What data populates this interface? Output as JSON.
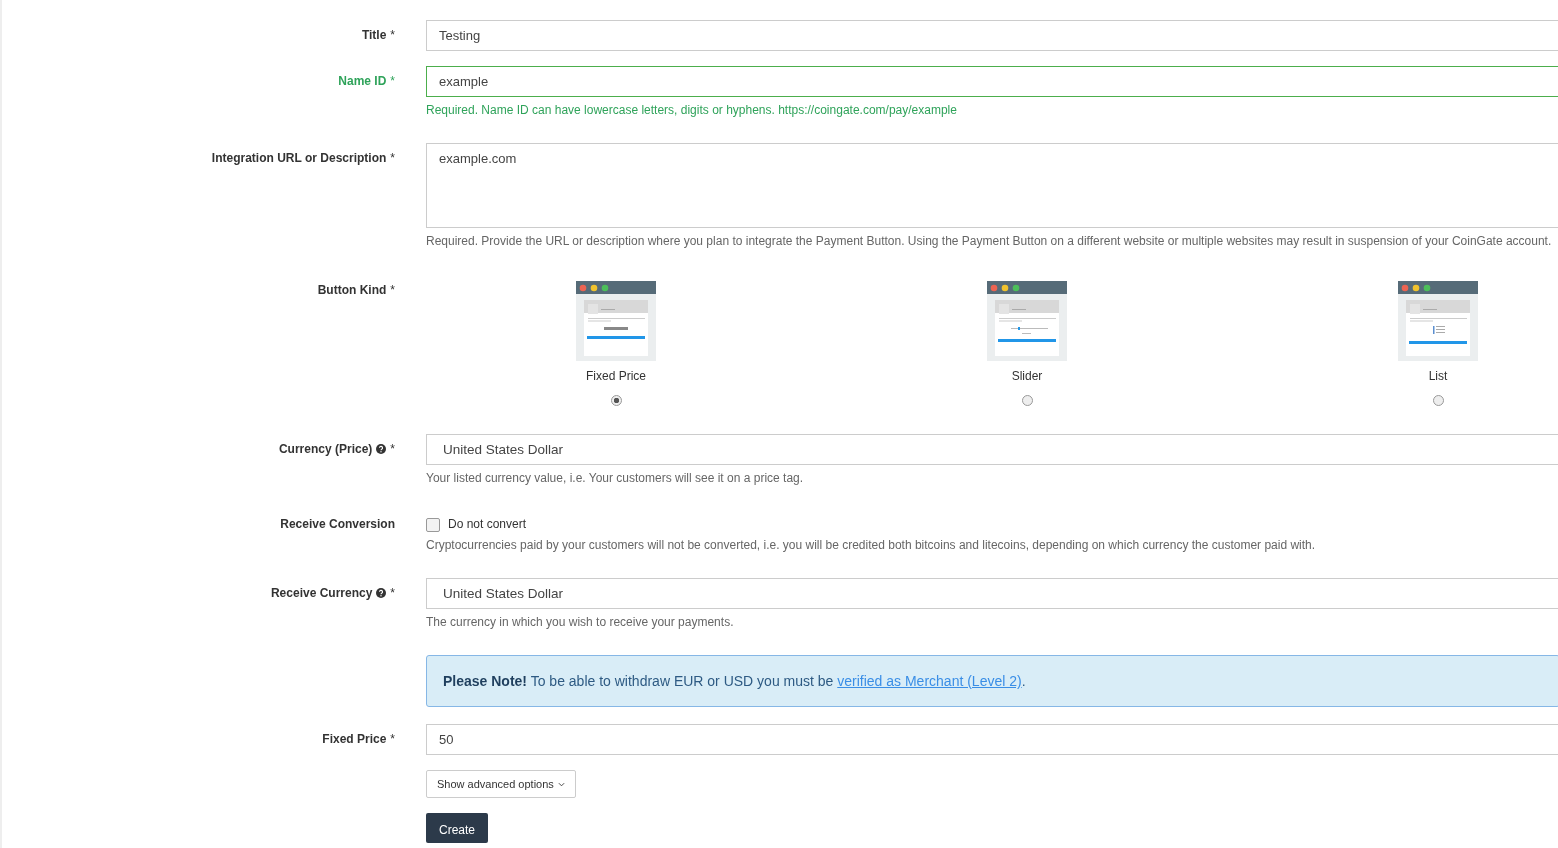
{
  "fields": [
    {
      "kind": "text",
      "label": "Title",
      "marker": "*",
      "valid": false,
      "value": "Testing"
    },
    {
      "kind": "text",
      "label": "Name ID",
      "marker": "*",
      "valid": true,
      "value": "example",
      "help": "Required. Name ID can have lowercase letters, digits or hyphens. https://coingate.com/pay/example"
    },
    {
      "kind": "textarea",
      "label": "Integration URL or Description",
      "marker": "*",
      "valid": false,
      "value": "example.com",
      "help": "Required. Provide the URL or description where you plan to integrate the Payment Button. Using the Payment Button on a different website or multiple websites may result in suspension of your CoinGate account."
    },
    {
      "kind": "choices",
      "label": "Button Kind",
      "marker": "*",
      "options": [
        {
          "label": "Fixed Price",
          "kind": "fixed",
          "selected": true
        },
        {
          "label": "Slider",
          "kind": "slider",
          "selected": false
        },
        {
          "label": "List",
          "kind": "list",
          "selected": false
        }
      ]
    },
    {
      "kind": "select",
      "label": "Currency (Price)",
      "help_icon": true,
      "marker": "*",
      "valid": false,
      "value": "United States Dollar",
      "help": "Your listed currency value, i.e. Your customers will see it on a price tag."
    },
    {
      "kind": "checkbox",
      "label": "Receive Conversion",
      "option": "Do not convert",
      "checked": false,
      "help": "Cryptocurrencies paid by your customers will not be converted, i.e. you will be credited both bitcoins and litecoins, depending on which currency the customer paid with."
    },
    {
      "kind": "select",
      "label": "Receive Currency",
      "help_icon": true,
      "marker": "*",
      "valid": false,
      "value": "United States Dollar",
      "help": "The currency in which you wish to receive your payments."
    },
    {
      "kind": "note",
      "text": "**Please Note!** To be able to withdraw EUR or USD you must be",
      "link": "verified as Merchant (Level 2)",
      "after": "."
    },
    {
      "kind": "text",
      "label": "Fixed Price",
      "marker": "*",
      "valid": false,
      "value": "50"
    }
  ],
  "advanced_button": "Show advanced options",
  "submit_button": "Create"
}
